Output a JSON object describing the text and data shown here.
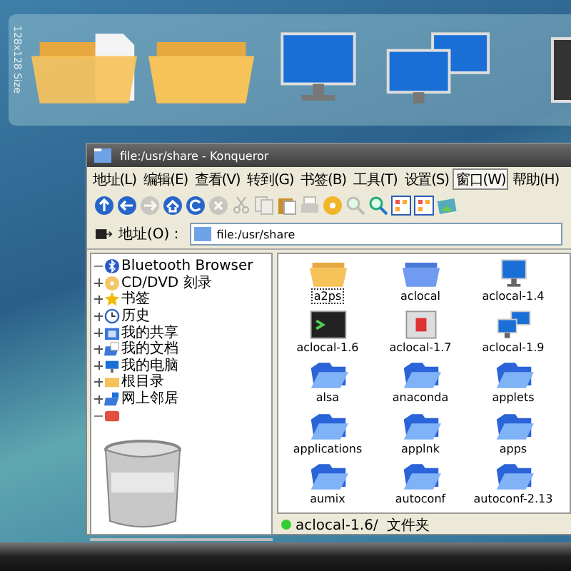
{
  "dock": {
    "caption": "128x128 Size"
  },
  "window": {
    "title": "file:/usr/share - Konqueror"
  },
  "menu": [
    {
      "label": "地址(L)",
      "selected": false
    },
    {
      "label": "编辑(E)",
      "selected": false
    },
    {
      "label": "查看(V)",
      "selected": false
    },
    {
      "label": "转到(G)",
      "selected": false
    },
    {
      "label": "书签(B)",
      "selected": false
    },
    {
      "label": "工具(T)",
      "selected": false
    },
    {
      "label": "设置(S)",
      "selected": false
    },
    {
      "label": "窗口(W)",
      "selected": true
    },
    {
      "label": "帮助(H)",
      "selected": false
    }
  ],
  "toolbar": [
    {
      "kind": "up",
      "disabled": false
    },
    {
      "kind": "back",
      "disabled": false
    },
    {
      "kind": "forward",
      "disabled": true
    },
    {
      "kind": "home",
      "disabled": false
    },
    {
      "kind": "reload",
      "disabled": false
    },
    {
      "kind": "stop",
      "disabled": true
    },
    {
      "kind": "cut",
      "disabled": true
    },
    {
      "kind": "copy",
      "disabled": true
    },
    {
      "kind": "paste",
      "disabled": false
    },
    {
      "kind": "print",
      "disabled": true
    },
    {
      "kind": "disc",
      "disabled": false
    },
    {
      "kind": "zoom-out",
      "disabled": true
    },
    {
      "kind": "zoom-in",
      "disabled": false
    },
    {
      "kind": "view",
      "disabled": false
    },
    {
      "kind": "view",
      "disabled": false
    },
    {
      "kind": "image",
      "disabled": false
    }
  ],
  "location": {
    "label": "地址(O)：",
    "value": "file:/usr/share"
  },
  "tree": [
    {
      "label": "Bluetooth Browser",
      "kind": "bluetooth",
      "expandable": false
    },
    {
      "label": "CD/DVD 刻录",
      "kind": "disc",
      "expandable": true
    },
    {
      "label": "书签",
      "kind": "star",
      "expandable": true
    },
    {
      "label": "历史",
      "kind": "clock",
      "expandable": true
    },
    {
      "label": "我的共享",
      "kind": "share",
      "expandable": true
    },
    {
      "label": "我的文档",
      "kind": "docs",
      "expandable": true
    },
    {
      "label": "我的电脑",
      "kind": "computer",
      "expandable": true
    },
    {
      "label": "根目录",
      "kind": "folder",
      "expandable": true
    },
    {
      "label": "网上邻居",
      "kind": "network",
      "expandable": true
    },
    {
      "kind": "red",
      "expandable": false
    }
  ],
  "files": [
    {
      "name": "a2ps",
      "kind": "folder-yellow",
      "selected": true
    },
    {
      "name": "aclocal",
      "kind": "folder-flat",
      "selected": false
    },
    {
      "name": "aclocal-1.4",
      "kind": "monitor",
      "selected": false
    },
    {
      "name": "aclocal-1.6",
      "kind": "terminal",
      "selected": false
    },
    {
      "name": "aclocal-1.7",
      "kind": "device",
      "selected": false
    },
    {
      "name": "aclocal-1.9",
      "kind": "monitors",
      "selected": false
    },
    {
      "name": "alsa",
      "kind": "folder",
      "selected": false
    },
    {
      "name": "anaconda",
      "kind": "folder",
      "selected": false
    },
    {
      "name": "applets",
      "kind": "folder",
      "selected": false
    },
    {
      "name": "applications",
      "kind": "folder",
      "selected": false
    },
    {
      "name": "applnk",
      "kind": "folder",
      "selected": false
    },
    {
      "name": "apps",
      "kind": "folder",
      "selected": false
    },
    {
      "name": "aumix",
      "kind": "folder",
      "selected": false
    },
    {
      "name": "autoconf",
      "kind": "folder",
      "selected": false
    },
    {
      "name": "autoconf-2.13",
      "kind": "folder",
      "selected": false
    }
  ],
  "status_bar": {
    "text": "aclocal-1.6/  文件夹"
  }
}
